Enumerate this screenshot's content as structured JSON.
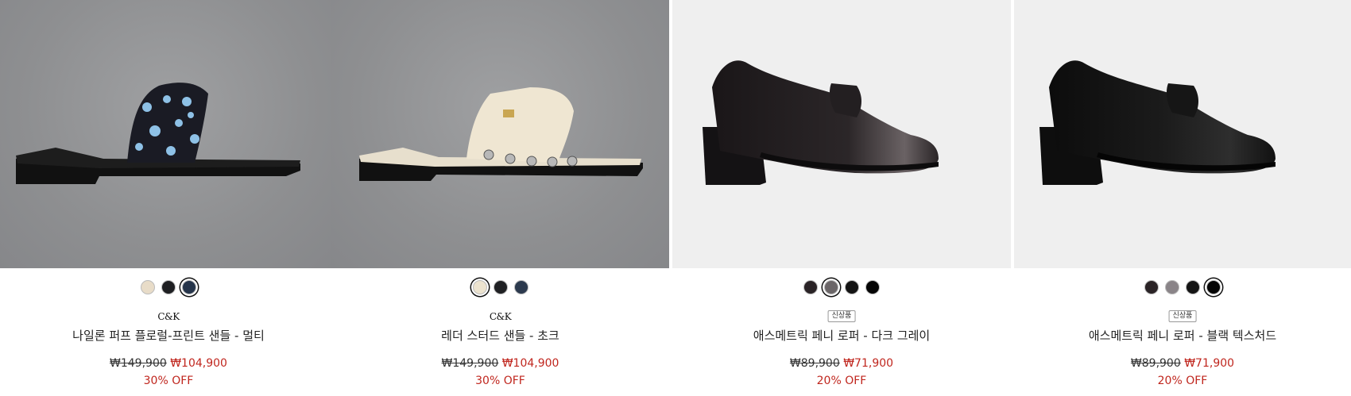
{
  "products": [
    {
      "brand": "C&K",
      "badge": "",
      "name": "나일론 퍼프 플로럴-프린트 샌들 - 멀티",
      "old_price": "₩149,900",
      "new_price": "₩104,900",
      "discount": "30% OFF",
      "swatches": [
        {
          "color": "#e8dcc8",
          "selected": false
        },
        {
          "color": "#1e1f22",
          "selected": false
        },
        {
          "color": "#25344a",
          "selected": true
        }
      ]
    },
    {
      "brand": "C&K",
      "badge": "",
      "name": "레더 스터드 샌들 - 초크",
      "old_price": "₩149,900",
      "new_price": "₩104,900",
      "discount": "30% OFF",
      "swatches": [
        {
          "color": "#ece3cf",
          "selected": true
        },
        {
          "color": "#1f2023",
          "selected": false
        },
        {
          "color": "#2c3a4e",
          "selected": false
        }
      ]
    },
    {
      "brand": "",
      "badge": "신상품",
      "name": "애스메트릭 페니 로퍼 - 다크 그레이",
      "old_price": "₩89,900",
      "new_price": "₩71,900",
      "discount": "20% OFF",
      "swatches": [
        {
          "color": "#2a2326",
          "selected": false
        },
        {
          "color": "#6b6668",
          "selected": true
        },
        {
          "color": "#141414",
          "selected": false
        },
        {
          "color": "#050505",
          "selected": false
        }
      ]
    },
    {
      "brand": "",
      "badge": "신상품",
      "name": "애스메트릭 페니 로퍼 - 블랙 텍스처드",
      "old_price": "₩89,900",
      "new_price": "₩71,900",
      "discount": "20% OFF",
      "swatches": [
        {
          "color": "#2a2326",
          "selected": false
        },
        {
          "color": "#8a8488",
          "selected": false
        },
        {
          "color": "#141414",
          "selected": false
        },
        {
          "color": "#050505",
          "selected": true
        }
      ]
    }
  ]
}
